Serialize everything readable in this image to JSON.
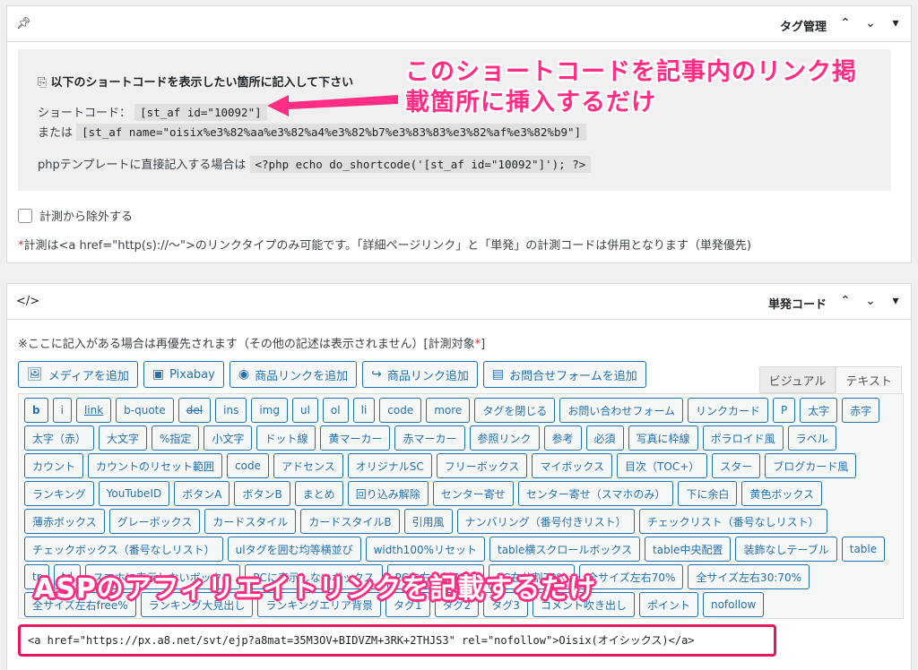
{
  "tag_panel": {
    "title": "タグ管理",
    "heading": "以下のショートコードを表示したい箇所に記入して下さい",
    "shortcode_label": "ショートコード：",
    "shortcode_value": "[st_af id=\"10092\"]",
    "or_label": "または",
    "name_code": "[st_af name=\"oisix%e3%82%aa%e3%82%a4%e3%82%b7%e3%83%83%e3%82%af%e3%82%b9\"]",
    "php_label": "phpテンプレートに直接記入する場合は",
    "php_code": "<?php echo do_shortcode('[st_af id=\"10092\"]'); ?>",
    "exclude_label": "計測から除外する",
    "note_star": "*",
    "note_text": "計測は<a href=\"http(s)://～\">のリンクタイプのみ可能です。「詳細ページリンク」と「単発」の計測コードは併用となります（単発優先)"
  },
  "callout_top": {
    "line1": "このショートコードを記事内のリンク掲",
    "line2": "載箇所に挿入するだけ"
  },
  "single_panel": {
    "title": "単発コード",
    "note_text": "※ここに記入がある場合は再優先されます（その他の記述は表示されません）[計測対象",
    "note_star": "*",
    "note_end": "]",
    "media_buttons": [
      "メディアを追加",
      "Pixabay",
      "商品リンクを追加",
      "商品リンク追加",
      "お問合せフォームを追加"
    ],
    "tabs": [
      "ビジュアル",
      "テキスト"
    ],
    "quicktags": [
      "b",
      "i",
      "link",
      "b-quote",
      "del",
      "ins",
      "img",
      "ul",
      "ol",
      "li",
      "code",
      "more",
      "タグを閉じる",
      "お問い合わせフォーム",
      "リンクカード",
      "P",
      "太字",
      "赤字",
      "太字（赤）",
      "大文字",
      "%指定",
      "小文字",
      "ドット線",
      "黄マーカー",
      "赤マーカー",
      "参照リンク",
      "参考",
      "必須",
      "写真に枠線",
      "ポラロイド風",
      "ラベル",
      "カウント",
      "カウントのリセット範囲",
      "code",
      "アドセンス",
      "オリジナルSC",
      "フリーボックス",
      "マイボックス",
      "目次（TOC+）",
      "スター",
      "ブログカード風",
      "ランキング",
      "YouTubeID",
      "ボタンA",
      "ボタンB",
      "まとめ",
      "回り込み解除",
      "センター寄せ",
      "センター寄せ（スマホのみ）",
      "下に余白",
      "黄色ボックス",
      "薄赤ボックス",
      "グレーボックス",
      "カードスタイル",
      "カードスタイルB",
      "引用風",
      "ナンバリング（番号付きリスト）",
      "チェックリスト（番号なしリスト）",
      "チェックボックス（番号なしリスト）",
      "ulタグを囲む均等横並び",
      "width100%リセット",
      "table横スクロールボックス",
      "table中央配置",
      "装飾なしテーブル",
      "table",
      "tr",
      "td",
      "スマホに表示しないボックス",
      "PCに表示しないボックス",
      "PC左右分割70%",
      "PC右分割70%",
      "全サイズ左右70%",
      "全サイズ左右30:70%",
      "全サイズ左右free%",
      "ランキング大見出し",
      "ランキングエリア背景",
      "タグ1",
      "タグ2",
      "タグ3",
      "コメント吹き出し",
      "ポイント",
      "nofollow"
    ],
    "editor_value": "<a href=\"https://px.a8.net/svt/ejp?a8mat=35M3OV+BIDVZM+3RK+2THJS3\" rel=\"nofollow\">Oisix(オイシックス)</a>"
  },
  "callout_bottom": "ASPのアフィリエイトリンクを記載するだけ",
  "icons": {
    "pin": "pin-icon",
    "code": "code-icon",
    "copy": "copy-icon",
    "chevron_up": "chevron-up-icon",
    "chevron_down": "chevron-down-icon",
    "triangle": "triangle-down-icon"
  },
  "colors": {
    "accent": "#2271b1",
    "callout": "#ff2d84",
    "editor_border": "#e8175d"
  }
}
